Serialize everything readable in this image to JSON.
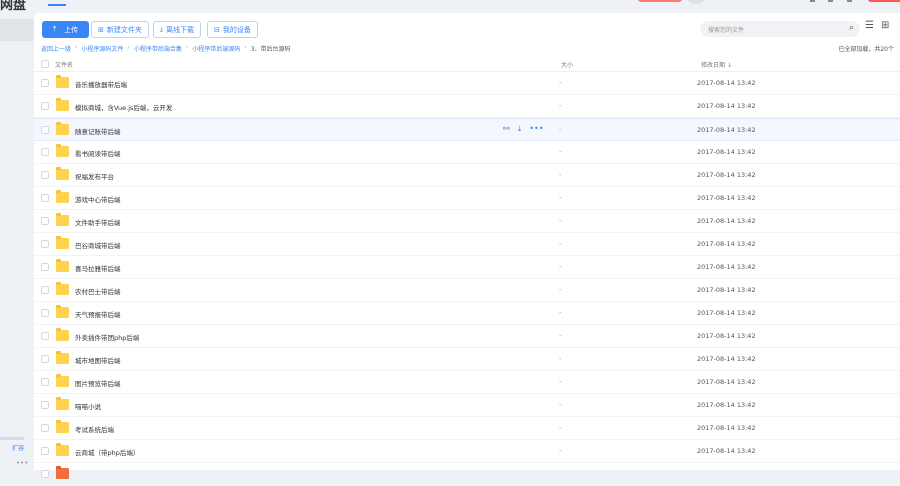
{
  "app": {
    "logo_text": "网盘"
  },
  "sidebar": {
    "expand_label": "扩容",
    "more_label": "•••"
  },
  "toolbar": {
    "upload": "上传",
    "new_folder": "新建文件夹",
    "offline_download": "离线下载",
    "my_devices": "我的设备"
  },
  "search": {
    "placeholder": "搜索您的文件"
  },
  "breadcrumb": [
    "返回上一级",
    "小程序源码文件",
    "小程序带后端合集",
    "小程序带后端源码",
    "3、带后台源码"
  ],
  "count_text": "已全部加载，共20个",
  "columns": {
    "name": "文件名",
    "size": "大小",
    "date": "修改日期"
  },
  "files": [
    {
      "name": "音乐播放器带后端",
      "size": "-",
      "date": "2017-08-14 13:42"
    },
    {
      "name": "模拟商城，含Vue.js后端，云开发",
      "size": "-",
      "date": "2017-08-14 13:42"
    },
    {
      "name": "随意记账带后端",
      "size": "-",
      "date": "2017-08-14 13:42"
    },
    {
      "name": "看书阅读带后端",
      "size": "-",
      "date": "2017-08-14 13:42"
    },
    {
      "name": "祝福发布平台",
      "size": "-",
      "date": "2017-08-14 13:42"
    },
    {
      "name": "游戏中心带后端",
      "size": "-",
      "date": "2017-08-14 13:42"
    },
    {
      "name": "文件助手带后端",
      "size": "-",
      "date": "2017-08-14 13:42"
    },
    {
      "name": "巴谷商城带后端",
      "size": "-",
      "date": "2017-08-14 13:42"
    },
    {
      "name": "喜马拉雅带后端",
      "size": "-",
      "date": "2017-08-14 13:42"
    },
    {
      "name": "农村巴士带后端",
      "size": "-",
      "date": "2017-08-14 13:42"
    },
    {
      "name": "天气预报带后端",
      "size": "-",
      "date": "2017-08-14 13:42"
    },
    {
      "name": "外卖插件带团php后端",
      "size": "-",
      "date": "2017-08-14 13:42"
    },
    {
      "name": "城市地图带后端",
      "size": "-",
      "date": "2017-08-14 13:42"
    },
    {
      "name": "图片预览带后端",
      "size": "-",
      "date": "2017-08-14 13:42"
    },
    {
      "name": "喵喵小说",
      "size": "-",
      "date": "2017-08-14 13:42"
    },
    {
      "name": "考试系统后端",
      "size": "-",
      "date": "2017-08-14 13:42"
    },
    {
      "name": "云商城（带php后端）",
      "size": "-",
      "date": "2017-08-14 13:42"
    }
  ],
  "hover_row_index": 2,
  "colors": {
    "accent": "#3b86f7",
    "folder": "#ffd24f"
  }
}
